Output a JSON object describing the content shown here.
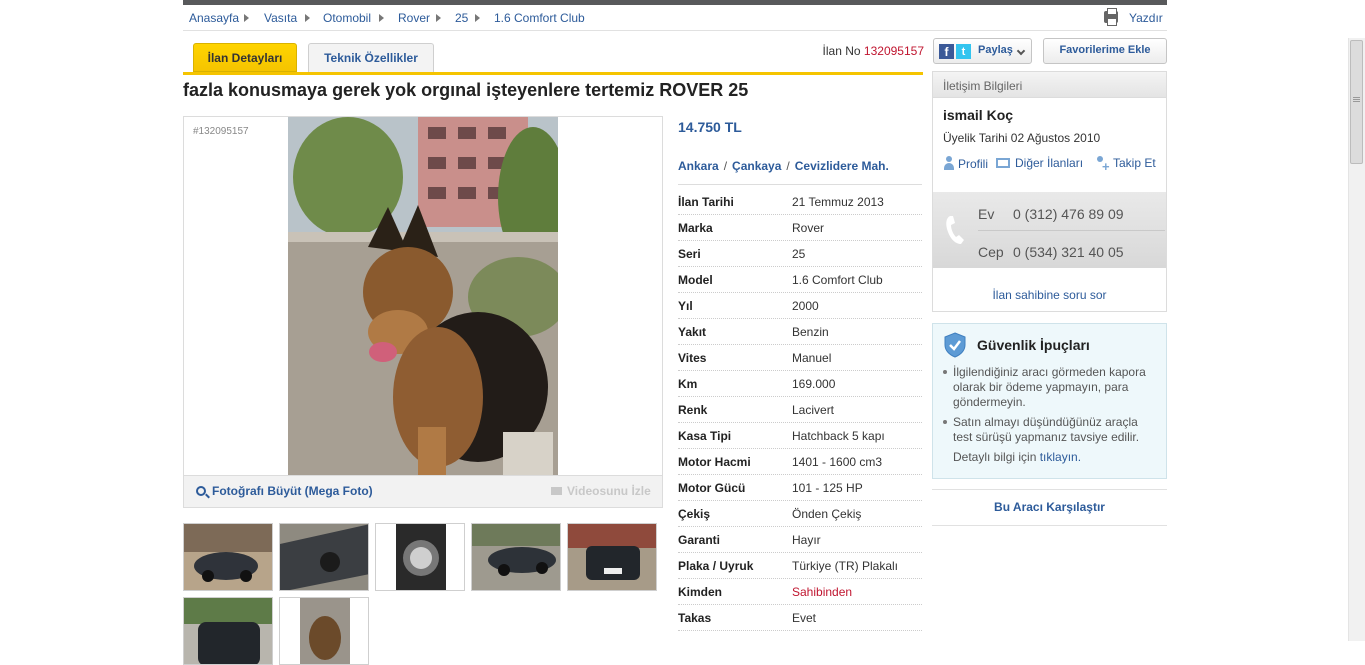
{
  "breadcrumb": {
    "items": [
      "Anasayfa",
      "Vasıta",
      "Otomobil",
      "Rover",
      "25",
      "1.6 Comfort Club"
    ],
    "print_label": "Yazdır"
  },
  "tabs": {
    "details": "İlan Detayları",
    "specs": "Teknik Özellikler"
  },
  "listing": {
    "no_label": "İlan No",
    "no_value": "132095157",
    "title": "fazla konusmaya gerek yok orgınal işteyenlere tertemiz ROVER 25",
    "photo_id": "#132095157",
    "zoom_label": "Fotoğrafı Büyüt (Mega Foto)",
    "video_label": "Videosunu İzle",
    "price": "14.750 TL",
    "location": [
      "Ankara",
      "Çankaya",
      "Cevizlidere Mah."
    ],
    "location_sep": "/"
  },
  "details": [
    {
      "key": "İlan Tarihi",
      "value": "21 Temmuz 2013"
    },
    {
      "key": "Marka",
      "value": "Rover"
    },
    {
      "key": "Seri",
      "value": "25"
    },
    {
      "key": "Model",
      "value": "1.6 Comfort Club"
    },
    {
      "key": "Yıl",
      "value": "2000"
    },
    {
      "key": "Yakıt",
      "value": "Benzin"
    },
    {
      "key": "Vites",
      "value": "Manuel"
    },
    {
      "key": "Km",
      "value": "169.000"
    },
    {
      "key": "Renk",
      "value": "Lacivert"
    },
    {
      "key": "Kasa Tipi",
      "value": "Hatchback 5 kapı"
    },
    {
      "key": "Motor Hacmi",
      "value": "1401 - 1600 cm3"
    },
    {
      "key": "Motor Gücü",
      "value": "101 - 125 HP"
    },
    {
      "key": "Çekiş",
      "value": "Önden Çekiş"
    },
    {
      "key": "Garanti",
      "value": "Hayır"
    },
    {
      "key": "Plaka / Uyruk",
      "value": "Türkiye (TR) Plakalı"
    },
    {
      "key": "Kimden",
      "value": "Sahibinden"
    },
    {
      "key": "Takas",
      "value": "Evet"
    }
  ],
  "actions": {
    "share_label": "Paylaş",
    "favorites_label": "Favorilerime Ekle"
  },
  "contact": {
    "header": "İletişim Bilgileri",
    "name": "ismail Koç",
    "member_since": "Üyelik Tarihi 02 Ağustos 2010",
    "links": [
      "Profili",
      "Diğer İlanları",
      "Takip Et"
    ],
    "phones": [
      {
        "label": "Ev",
        "number": "0 (312) 476 89 09"
      },
      {
        "label": "Cep",
        "number": "0 (534) 321 40 05"
      }
    ],
    "ask_label": "İlan sahibine soru sor"
  },
  "safety": {
    "title": "Güvenlik İpuçları",
    "tips": [
      "İlgilendiğiniz aracı görmeden kapora olarak bir ödeme yapmayın, para göndermeyin.",
      "Satın almayı düşündüğünüz araçla test sürüşü yapmanız tavsiye edilir."
    ],
    "more_prefix": "Detaylı bilgi için",
    "more_link": "tıklayın."
  },
  "compare_label": "Bu Aracı Karşılaştır",
  "colors": {
    "link": "#2d5b9a",
    "accent_yellow": "#f5c400",
    "listing_no": "#c0152f"
  }
}
